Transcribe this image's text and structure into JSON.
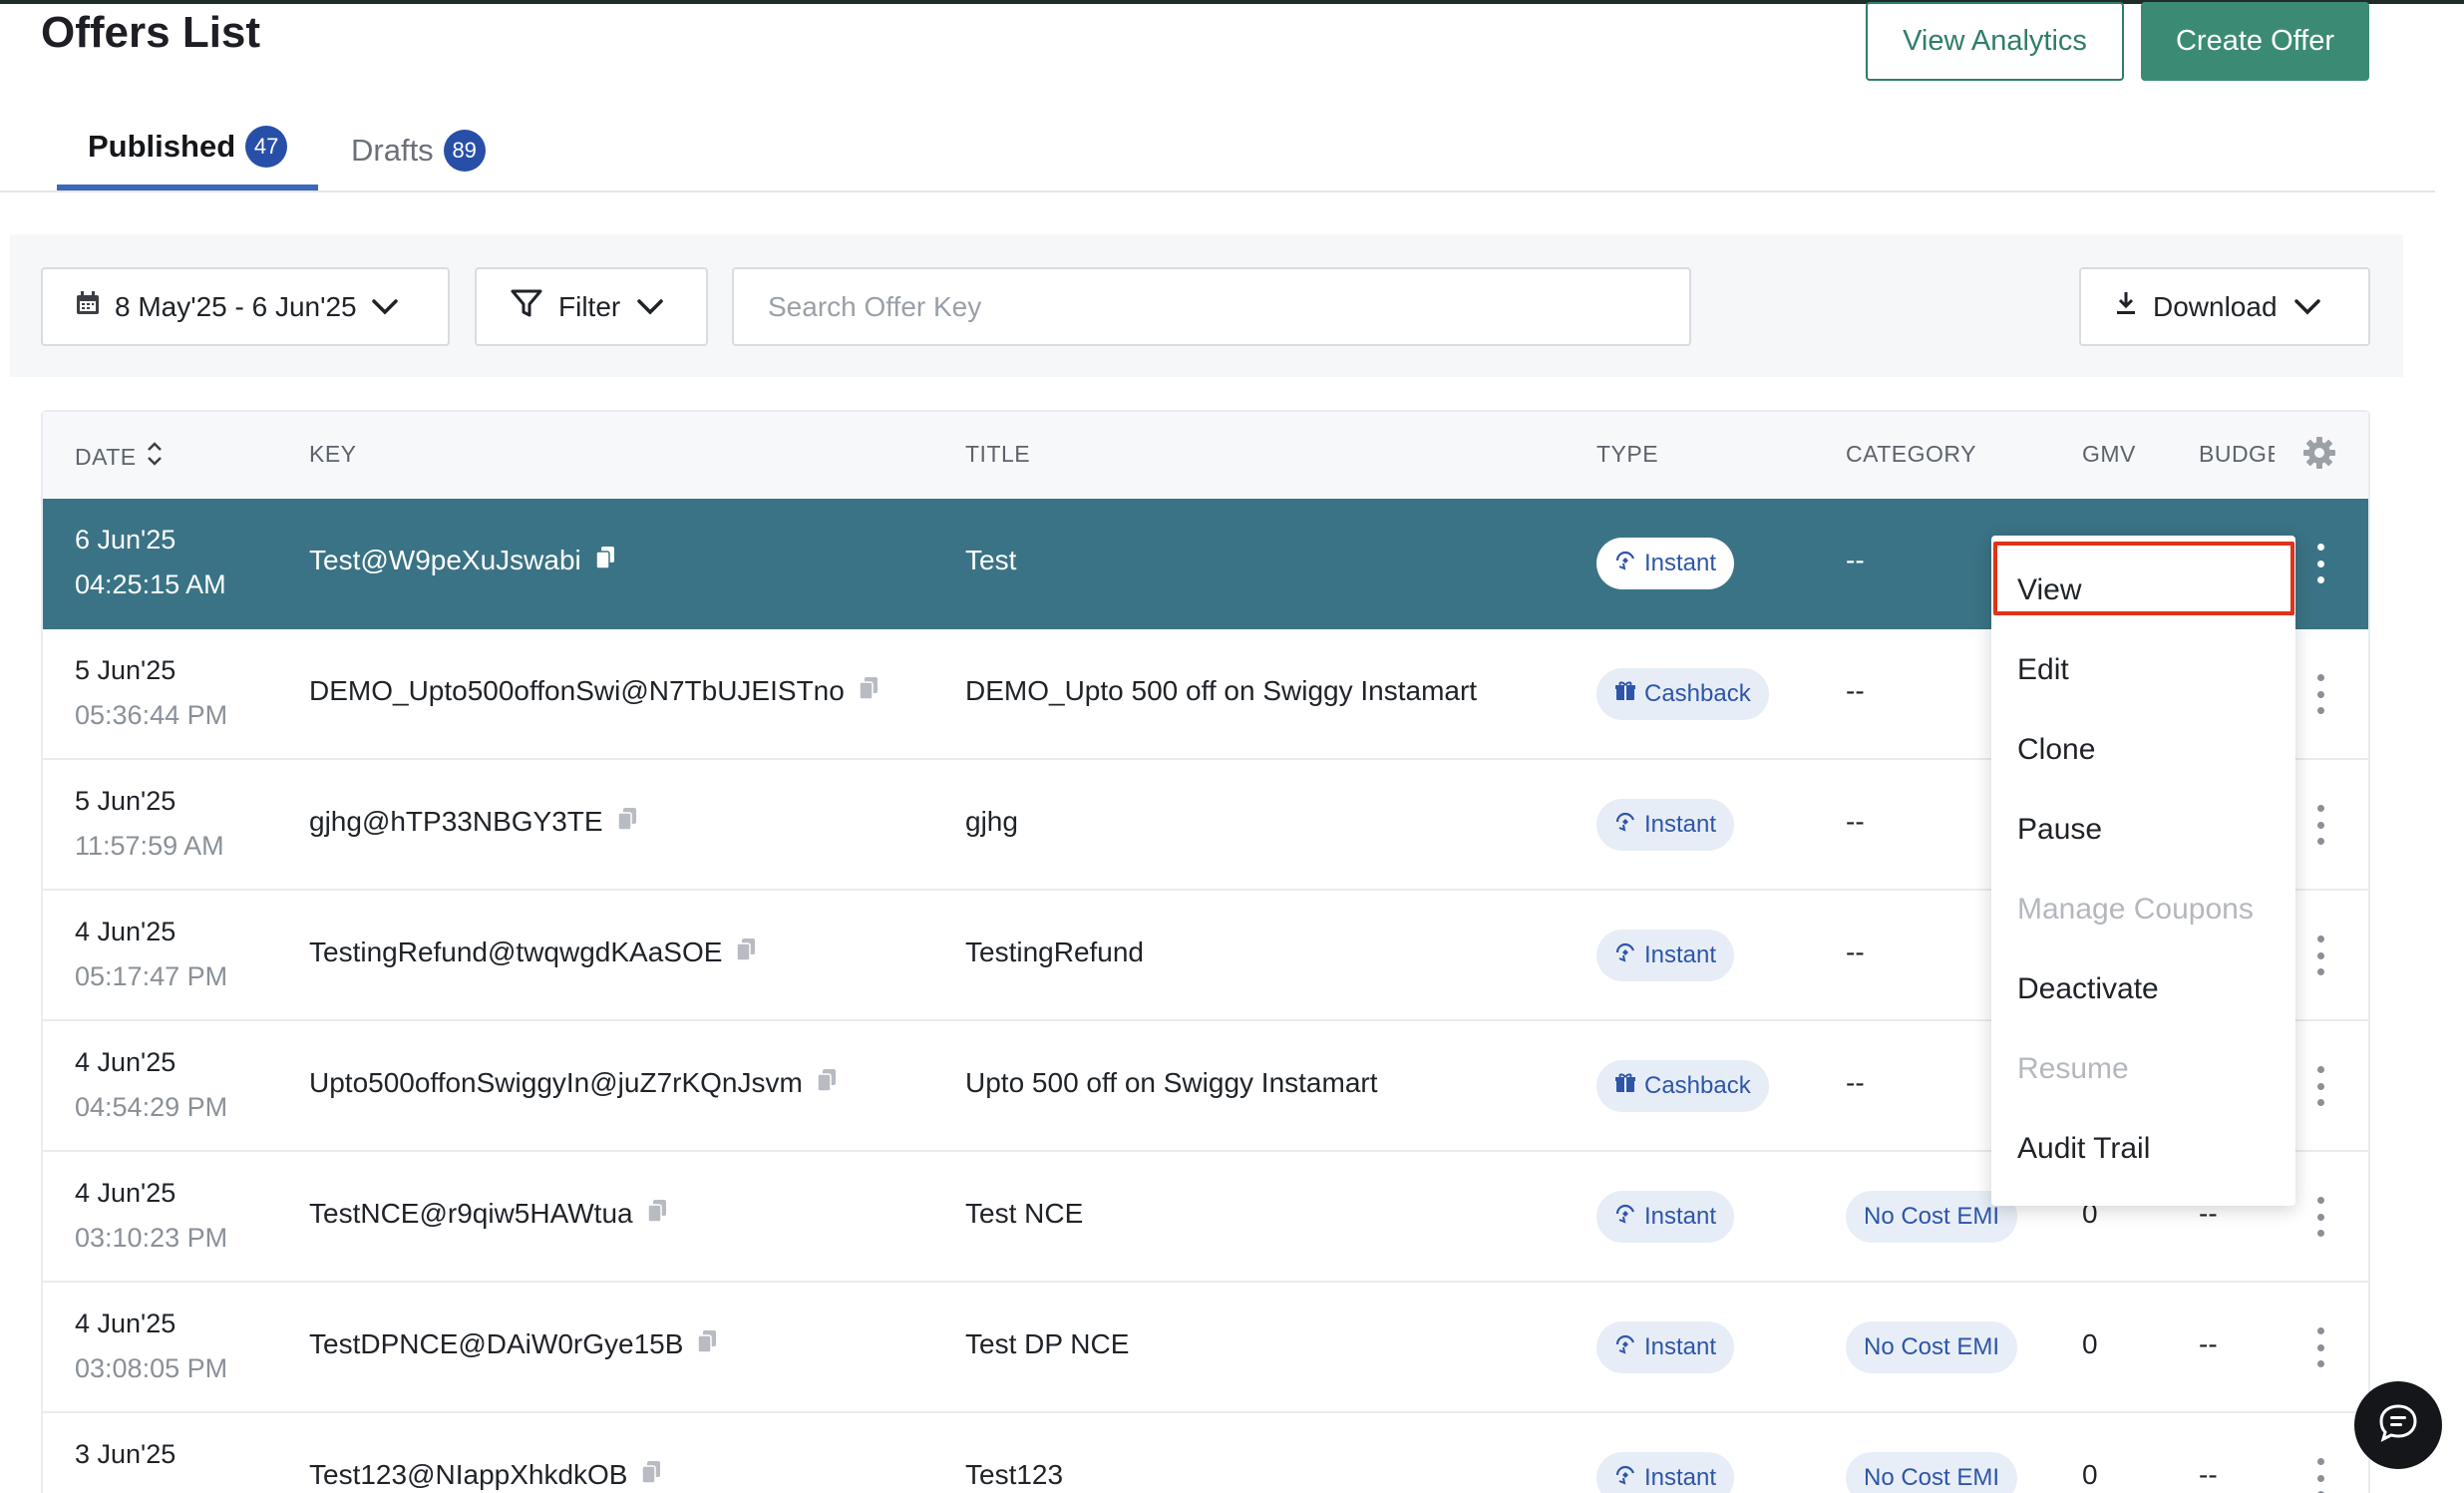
{
  "header": {
    "title": "Offers List",
    "view_analytics_label": "View Analytics",
    "create_offer_label": "Create Offer",
    "accent_color": "#3b8b74"
  },
  "tabs": [
    {
      "label": "Published",
      "count": "47",
      "active": true
    },
    {
      "label": "Drafts",
      "count": "89",
      "active": false
    }
  ],
  "toolbar": {
    "date_range": "8 May'25 - 6 Jun'25",
    "filter_label": "Filter",
    "search_placeholder": "Search Offer Key",
    "download_label": "Download"
  },
  "table": {
    "columns": [
      "DATE",
      "KEY",
      "TITLE",
      "TYPE",
      "CATEGORY",
      "GMV",
      "BUDGE"
    ],
    "rows": [
      {
        "date": "6 Jun'25",
        "time": "04:25:15 AM",
        "key": "Test@W9peXuJswabi",
        "title": "Test",
        "type": "Instant",
        "category": "--",
        "gmv": "",
        "budget": "",
        "selected": true
      },
      {
        "date": "5 Jun'25",
        "time": "05:36:44 PM",
        "key": "DEMO_Upto500offonSwi@N7TbUJEISTno",
        "title": "DEMO_Upto 500 off on Swiggy Instamart",
        "type": "Cashback",
        "category": "--",
        "gmv": "",
        "budget": ""
      },
      {
        "date": "5 Jun'25",
        "time": "11:57:59 AM",
        "key": "gjhg@hTP33NBGY3TE",
        "title": "gjhg",
        "type": "Instant",
        "category": "--",
        "gmv": "",
        "budget": ""
      },
      {
        "date": "4 Jun'25",
        "time": "05:17:47 PM",
        "key": "TestingRefund@twqwgdKAaSOE",
        "title": "TestingRefund",
        "type": "Instant",
        "category": "--",
        "gmv": "",
        "budget": ""
      },
      {
        "date": "4 Jun'25",
        "time": "04:54:29 PM",
        "key": "Upto500offonSwiggyIn@juZ7rKQnJsvm",
        "title": "Upto 500 off on Swiggy Instamart",
        "type": "Cashback",
        "category": "--",
        "gmv": "",
        "budget": ""
      },
      {
        "date": "4 Jun'25",
        "time": "03:10:23 PM",
        "key": "TestNCE@r9qiw5HAWtua",
        "title": "Test NCE",
        "type": "Instant",
        "category": "No Cost EMI",
        "gmv": "0",
        "budget": "--"
      },
      {
        "date": "4 Jun'25",
        "time": "03:08:05 PM",
        "key": "TestDPNCE@DAiW0rGye15B",
        "title": "Test DP NCE",
        "type": "Instant",
        "category": "No Cost EMI",
        "gmv": "0",
        "budget": "--"
      },
      {
        "date": "3 Jun'25",
        "time": "",
        "key": "Test123@NIappXhkdkOB",
        "title": "Test123",
        "type": "Instant",
        "category": "No Cost EMI",
        "gmv": "0",
        "budget": "--"
      }
    ]
  },
  "menu": {
    "items": [
      {
        "label": "View",
        "disabled": false
      },
      {
        "label": "Edit",
        "disabled": false
      },
      {
        "label": "Clone",
        "disabled": false
      },
      {
        "label": "Pause",
        "disabled": false
      },
      {
        "label": "Manage Coupons",
        "disabled": true
      },
      {
        "label": "Deactivate",
        "disabled": false
      },
      {
        "label": "Resume",
        "disabled": true
      },
      {
        "label": "Audit Trail",
        "disabled": false
      }
    ]
  },
  "colors": {
    "selected_row": "#3a7385",
    "tab_badge": "#284fa8",
    "highlight_border": "#e0321c"
  }
}
